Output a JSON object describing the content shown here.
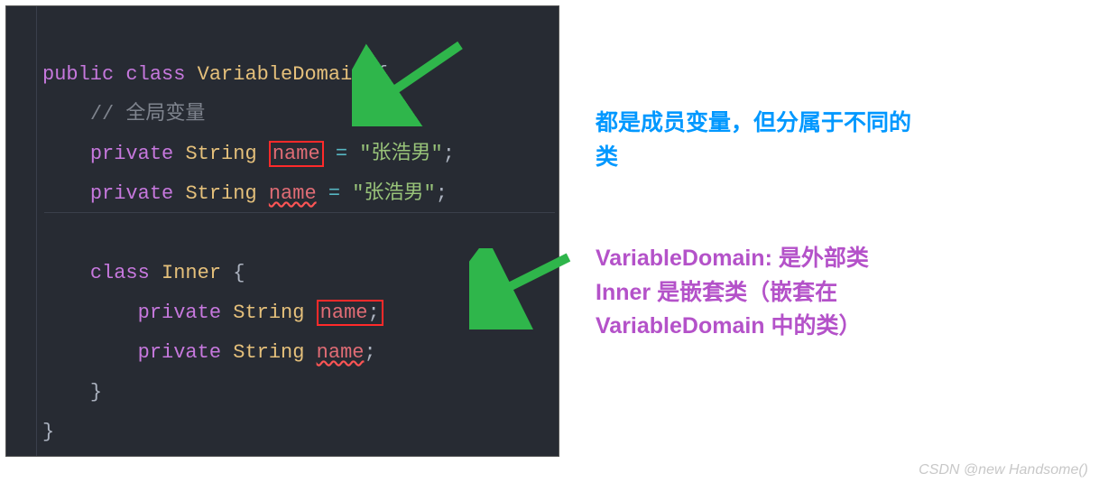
{
  "code": {
    "line1": {
      "kw_public": "public",
      "kw_class": "class",
      "classname": "VariableDomain",
      "brace": "{"
    },
    "line2": {
      "comment": "// 全局变量"
    },
    "line3": {
      "kw_private": "private",
      "type": "String",
      "var": "name",
      "eq": "=",
      "str": "\"张浩男\"",
      "semi": ";"
    },
    "line4": {
      "kw_private": "private",
      "type": "String",
      "var": "name",
      "eq": "=",
      "str": "\"张浩男\"",
      "semi": ";"
    },
    "line6": {
      "kw_class": "class",
      "classname": "Inner",
      "brace": "{"
    },
    "line7": {
      "kw_private": "private",
      "type": "String",
      "var": "name",
      "semi": ";"
    },
    "line8": {
      "kw_private": "private",
      "type": "String",
      "var": "name",
      "semi": ";"
    },
    "line9": {
      "brace": "}"
    },
    "line10": {
      "brace": "}"
    }
  },
  "annotations": {
    "blue_line1": "都是成员变量，但分属于不同的",
    "blue_line2": "类",
    "purple_line1": "VariableDomain: 是外部类",
    "purple_line2": "Inner 是嵌套类（嵌套在",
    "purple_line3": "VariableDomain 中的类）"
  },
  "watermark": "CSDN @new Handsome()"
}
